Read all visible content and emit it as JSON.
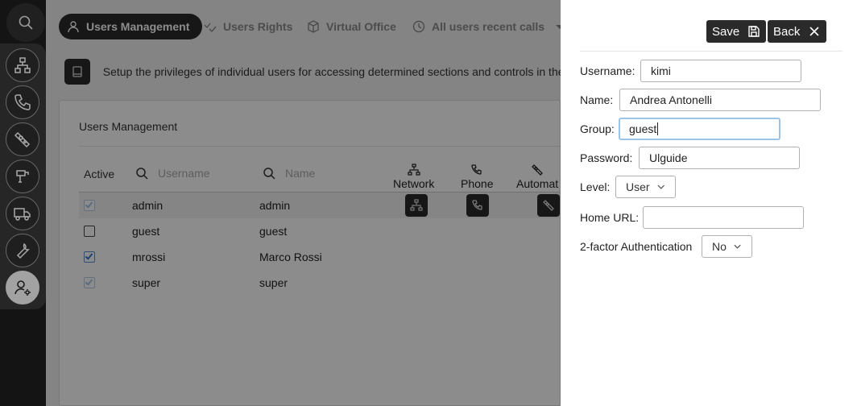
{
  "sidebar": {
    "items": [
      {
        "icon": "network-icon"
      },
      {
        "icon": "phone-icon"
      },
      {
        "icon": "automation-icon"
      },
      {
        "icon": "intercom-icon"
      },
      {
        "icon": "truck-icon"
      },
      {
        "icon": "wrench-icon"
      },
      {
        "icon": "user-settings-icon",
        "active": true
      }
    ]
  },
  "tabs": [
    {
      "label": "Users Management",
      "icon": "user-icon",
      "active": true
    },
    {
      "label": "Users Rights",
      "icon": "rights-icon"
    },
    {
      "label": "Virtual Office",
      "icon": "cube-icon"
    },
    {
      "label": "All users recent calls",
      "icon": "clock-icon"
    }
  ],
  "banner": {
    "text": "Setup the privileges of individual users for accessing determined sections and controls in the"
  },
  "panel": {
    "title": "Users Management",
    "headers": {
      "active": "Active",
      "username_placeholder": "Username",
      "name_placeholder": "Name",
      "network": "Network",
      "phone": "Phone",
      "automation": "Automat"
    },
    "rows": [
      {
        "username": "admin",
        "name": "admin",
        "active": true,
        "faded": true
      },
      {
        "username": "guest",
        "name": "guest",
        "active": false
      },
      {
        "username": "mrossi",
        "name": "Marco Rossi",
        "active": true
      },
      {
        "username": "super",
        "name": "super",
        "active": true,
        "faded": true
      }
    ]
  },
  "drawer": {
    "save_label": "Save",
    "back_label": "Back",
    "fields": {
      "username": {
        "label": "Username:",
        "value": "kimi"
      },
      "name": {
        "label": "Name:",
        "value": "Andrea Antonelli"
      },
      "group": {
        "label": "Group:",
        "value": "guest"
      },
      "password": {
        "label": "Password:",
        "value": "Ulguide"
      },
      "level": {
        "label": "Level:",
        "value": "User"
      },
      "home_url": {
        "label": "Home URL:",
        "value": ""
      },
      "two_factor": {
        "label": "2-factor Authentication",
        "value": "No"
      }
    }
  },
  "colors": {
    "sidebar": "#1b1b1b",
    "dark_button": "#2a2a2a",
    "focus_border": "#9cc3e8",
    "checkbox_blue": "#3a78cc"
  }
}
